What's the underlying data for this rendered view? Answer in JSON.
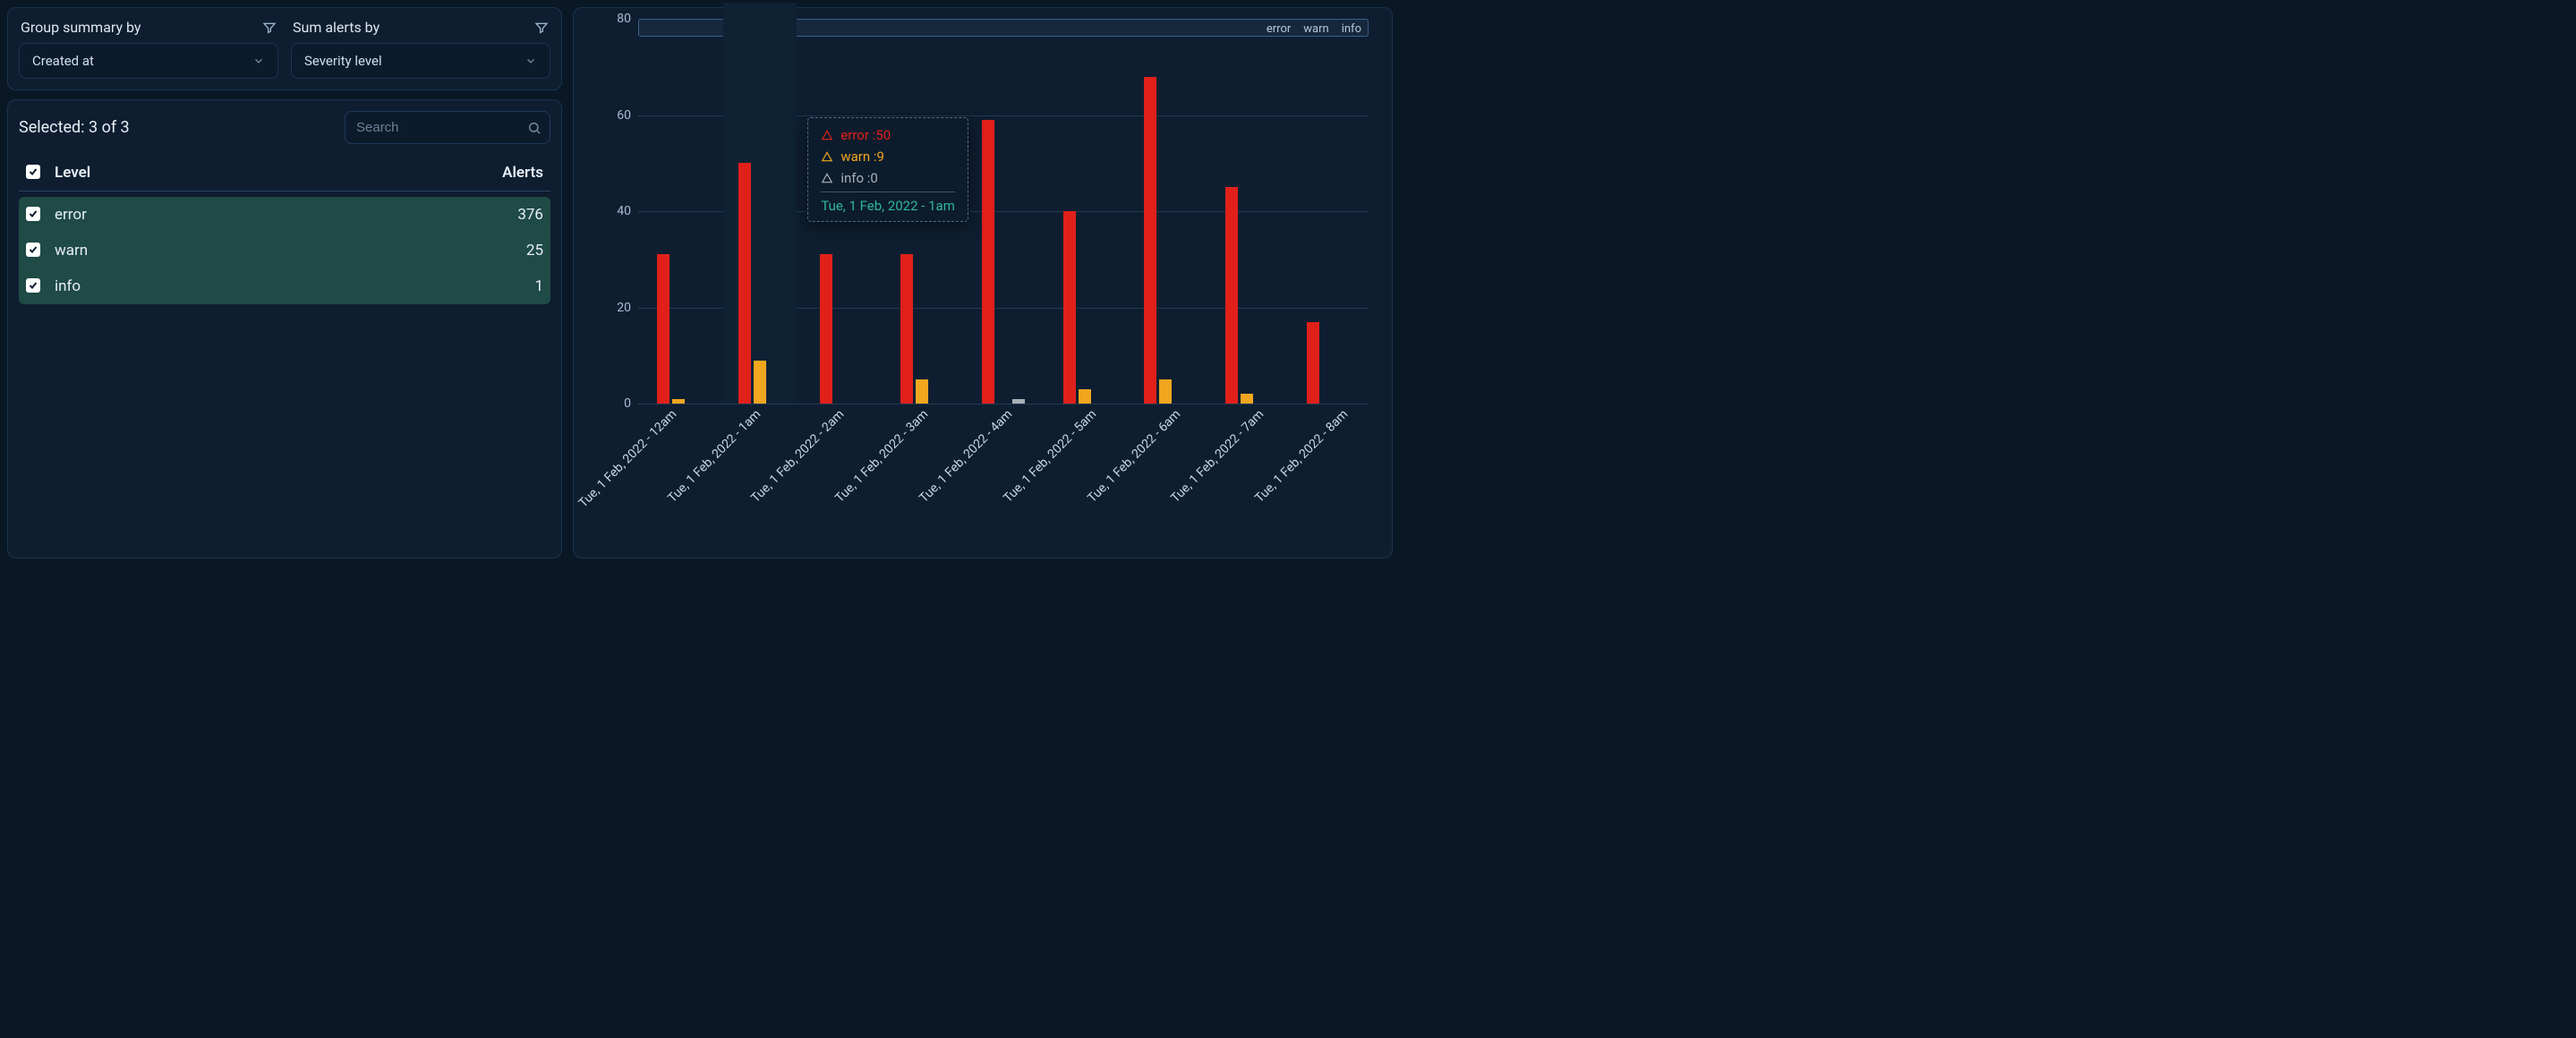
{
  "filters": {
    "group_label": "Group summary by",
    "group_value": "Created at",
    "sum_label": "Sum alerts by",
    "sum_value": "Severity level"
  },
  "list": {
    "selected_label": "Selected: 3 of 3",
    "search_placeholder": "Search",
    "header_level": "Level",
    "header_alerts": "Alerts",
    "rows": [
      {
        "level": "error",
        "alerts": "376"
      },
      {
        "level": "warn",
        "alerts": "25"
      },
      {
        "level": "info",
        "alerts": "1"
      }
    ]
  },
  "tooltip": {
    "error_label": "error :50",
    "warn_label": "warn :9",
    "info_label": "info :0",
    "category": "Tue, 1 Feb, 2022 - 1am"
  },
  "legend": {
    "error": "error",
    "warn": "warn",
    "info": "info"
  },
  "chart_data": {
    "type": "bar",
    "title": "",
    "xlabel": "",
    "ylabel": "",
    "ylim": [
      0,
      80
    ],
    "y_ticks": [
      0,
      20,
      40,
      60,
      80
    ],
    "legend_position": "top-right",
    "categories": [
      "Tue, 1 Feb, 2022 - 12am",
      "Tue, 1 Feb, 2022 - 1am",
      "Tue, 1 Feb, 2022 - 2am",
      "Tue, 1 Feb, 2022 - 3am",
      "Tue, 1 Feb, 2022 - 4am",
      "Tue, 1 Feb, 2022 - 5am",
      "Tue, 1 Feb, 2022 - 6am",
      "Tue, 1 Feb, 2022 - 7am",
      "Tue, 1 Feb, 2022 - 8am"
    ],
    "series": [
      {
        "name": "error",
        "color": "#e1201a",
        "values": [
          31,
          50,
          31,
          31,
          59,
          40,
          68,
          45,
          17
        ]
      },
      {
        "name": "warn",
        "color": "#f0a61f",
        "values": [
          1,
          9,
          0,
          5,
          0,
          3,
          5,
          2,
          0
        ]
      },
      {
        "name": "info",
        "color": "#a8b0b7",
        "values": [
          0,
          0,
          0,
          0,
          1,
          0,
          0,
          0,
          0
        ]
      }
    ],
    "highlighted_index": 1
  }
}
